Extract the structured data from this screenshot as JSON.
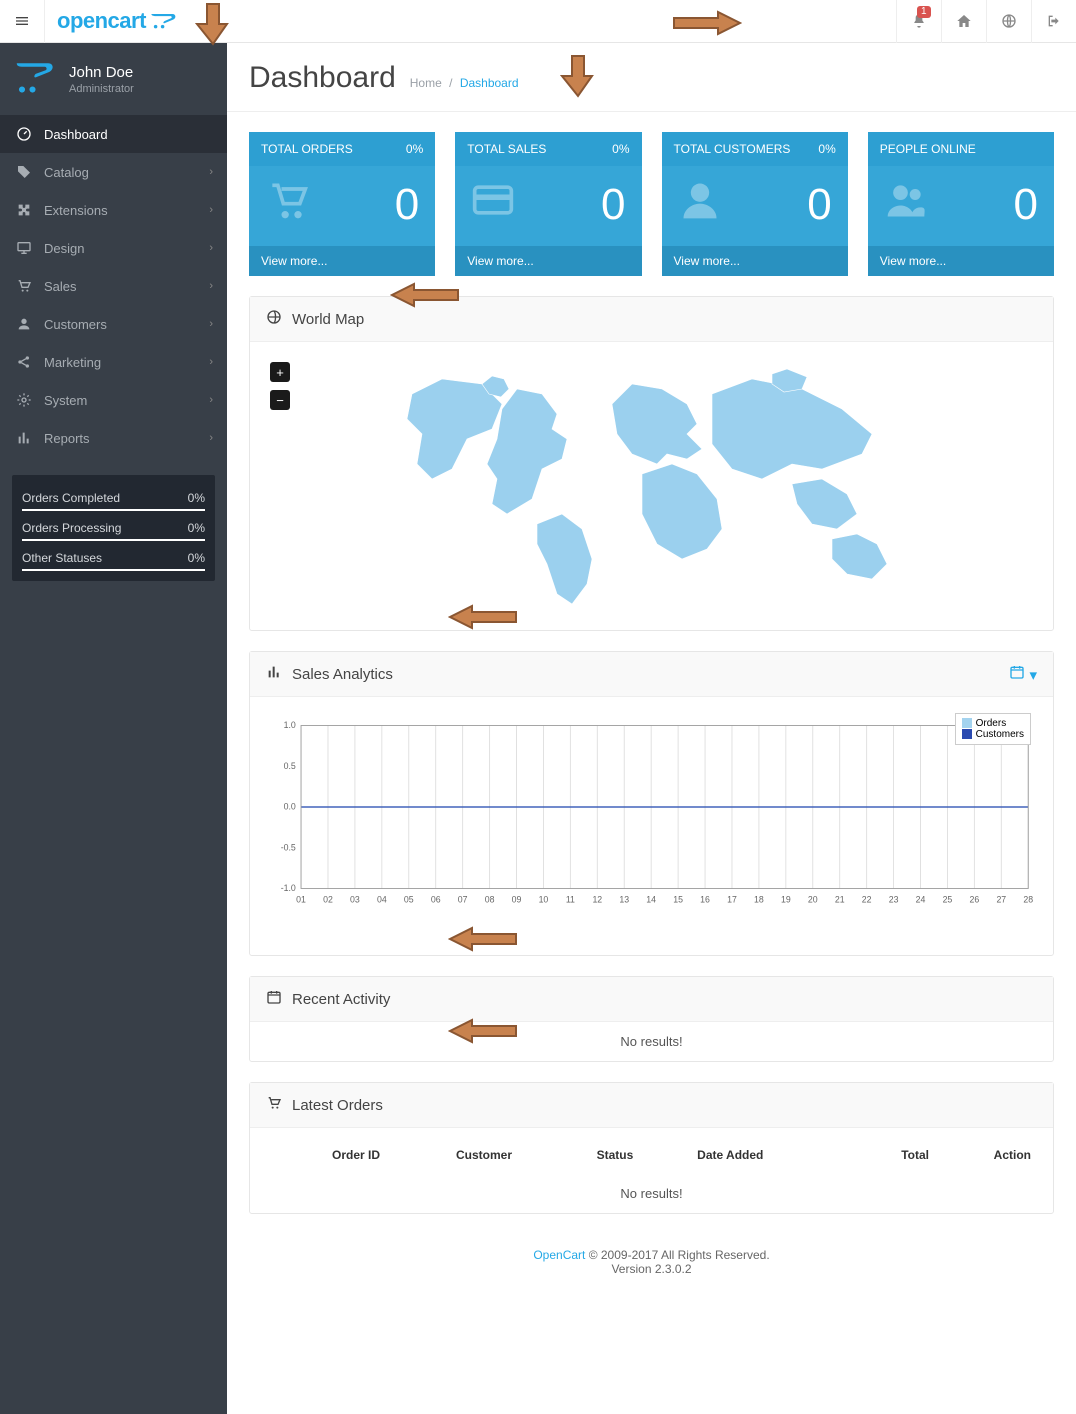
{
  "brand": "opencart",
  "top": {
    "notif_count": "1"
  },
  "profile": {
    "name": "John Doe",
    "role": "Administrator"
  },
  "nav": {
    "dashboard": "Dashboard",
    "catalog": "Catalog",
    "extensions": "Extensions",
    "design": "Design",
    "sales": "Sales",
    "customers": "Customers",
    "marketing": "Marketing",
    "system": "System",
    "reports": "Reports"
  },
  "stats": {
    "completed_label": "Orders Completed",
    "completed_val": "0%",
    "processing_label": "Orders Processing",
    "processing_val": "0%",
    "other_label": "Other Statuses",
    "other_val": "0%"
  },
  "page": {
    "title": "Dashboard",
    "crumb_home": "Home",
    "crumb_current": "Dashboard"
  },
  "tiles": {
    "t1_label": "TOTAL ORDERS",
    "t1_pct": "0%",
    "t1_val": "0",
    "t1_more": "View more...",
    "t2_label": "TOTAL SALES",
    "t2_pct": "0%",
    "t2_val": "0",
    "t2_more": "View more...",
    "t3_label": "TOTAL CUSTOMERS",
    "t3_pct": "0%",
    "t3_val": "0",
    "t3_more": "View more...",
    "t4_label": "PEOPLE ONLINE",
    "t4_val": "0",
    "t4_more": "View more..."
  },
  "panels": {
    "map_title": "World Map",
    "sales_title": "Sales Analytics",
    "activity_title": "Recent Activity",
    "activity_empty": "No results!",
    "orders_title": "Latest Orders",
    "orders_empty": "No results!"
  },
  "orders_cols": {
    "id": "Order ID",
    "cust": "Customer",
    "status": "Status",
    "date": "Date Added",
    "total": "Total",
    "action": "Action"
  },
  "footer": {
    "brand": "OpenCart",
    "rights": " © 2009-2017 All Rights Reserved.",
    "version": "Version 2.3.0.2"
  },
  "chart_data": {
    "type": "line",
    "title": "Sales Analytics",
    "xlabel": "",
    "ylabel": "",
    "ylim": [
      -1.0,
      1.0
    ],
    "yticks": [
      -1.0,
      -0.5,
      0.0,
      0.5,
      1.0
    ],
    "categories": [
      "01",
      "02",
      "03",
      "04",
      "05",
      "06",
      "07",
      "08",
      "09",
      "10",
      "11",
      "12",
      "13",
      "14",
      "15",
      "16",
      "17",
      "18",
      "19",
      "20",
      "21",
      "22",
      "23",
      "24",
      "25",
      "26",
      "27",
      "28"
    ],
    "series": [
      {
        "name": "Orders",
        "color": "#a3d3ef",
        "values": [
          0,
          0,
          0,
          0,
          0,
          0,
          0,
          0,
          0,
          0,
          0,
          0,
          0,
          0,
          0,
          0,
          0,
          0,
          0,
          0,
          0,
          0,
          0,
          0,
          0,
          0,
          0,
          0
        ]
      },
      {
        "name": "Customers",
        "color": "#2a4ab0",
        "values": [
          0,
          0,
          0,
          0,
          0,
          0,
          0,
          0,
          0,
          0,
          0,
          0,
          0,
          0,
          0,
          0,
          0,
          0,
          0,
          0,
          0,
          0,
          0,
          0,
          0,
          0,
          0,
          0
        ]
      }
    ]
  }
}
